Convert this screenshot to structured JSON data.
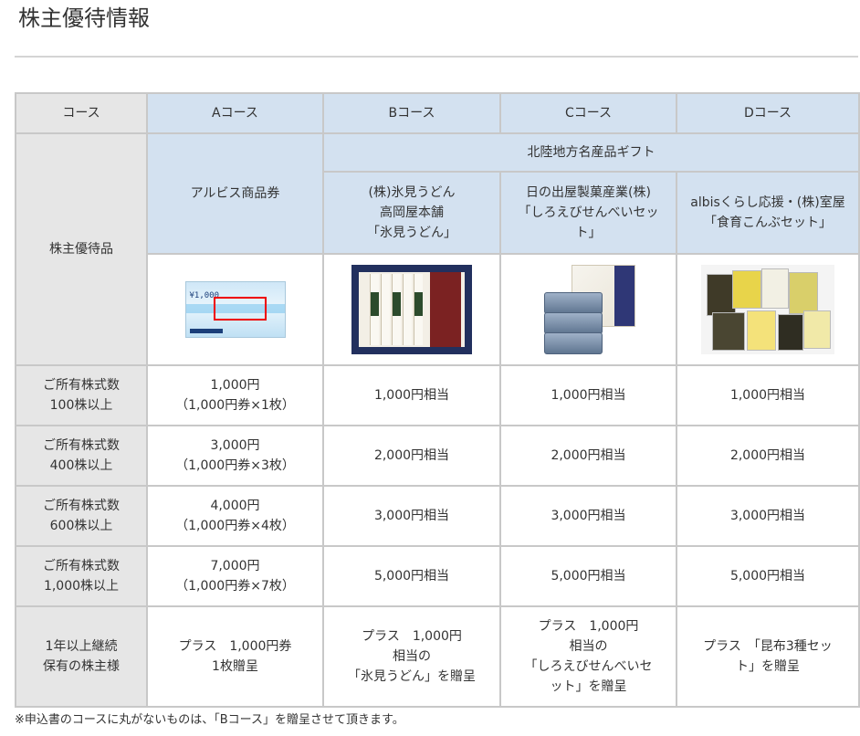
{
  "page": {
    "title": "株主優待情報"
  },
  "table": {
    "header": {
      "course": "コース",
      "a": "Aコース",
      "b": "Bコース",
      "c": "Cコース",
      "d": "Dコース"
    },
    "product_label": "株主優待品",
    "hokuriku_gift": "北陸地方名産品ギフト",
    "products": {
      "a": [
        "アルビス商品券"
      ],
      "b": [
        "(株)氷見うどん",
        "高岡屋本舗",
        "「氷見うどん」"
      ],
      "c": [
        "日の出屋製菓産業(株)",
        "「しろえびせんべいセッ",
        "ト」"
      ],
      "d": [
        "albisくらし応援・(株)室屋",
        "「食育こんぶセット」"
      ]
    },
    "voucher_image_text": "¥1,000",
    "rows": [
      {
        "label": [
          "ご所有株式数",
          "100株以上"
        ],
        "a": [
          "1,000円",
          "（1,000円券×1枚）"
        ],
        "b": "1,000円相当",
        "c": "1,000円相当",
        "d": "1,000円相当"
      },
      {
        "label": [
          "ご所有株式数",
          "400株以上"
        ],
        "a": [
          "3,000円",
          "（1,000円券×3枚）"
        ],
        "b": "2,000円相当",
        "c": "2,000円相当",
        "d": "2,000円相当"
      },
      {
        "label": [
          "ご所有株式数",
          "600株以上"
        ],
        "a": [
          "4,000円",
          "（1,000円券×4枚）"
        ],
        "b": "3,000円相当",
        "c": "3,000円相当",
        "d": "3,000円相当"
      },
      {
        "label": [
          "ご所有株式数",
          "1,000株以上"
        ],
        "a": [
          "7,000円",
          "（1,000円券×7枚）"
        ],
        "b": "5,000円相当",
        "c": "5,000円相当",
        "d": "5,000円相当"
      }
    ],
    "longterm": {
      "label": [
        "1年以上継続",
        "保有の株主様"
      ],
      "a": [
        "プラス　1,000円券",
        "1枚贈呈"
      ],
      "b": [
        "プラス　1,000円",
        "相当の",
        "「氷見うどん」を贈呈"
      ],
      "c": [
        "プラス　1,000円",
        "相当の",
        "「しろえびせんべいセ",
        "ット」を贈呈"
      ],
      "d": [
        "プラス　「昆布3種セッ",
        "ト」を贈呈"
      ]
    }
  },
  "note": "※申込書のコースに丸がないものは、「Bコース」を贈呈させて頂きます。"
}
